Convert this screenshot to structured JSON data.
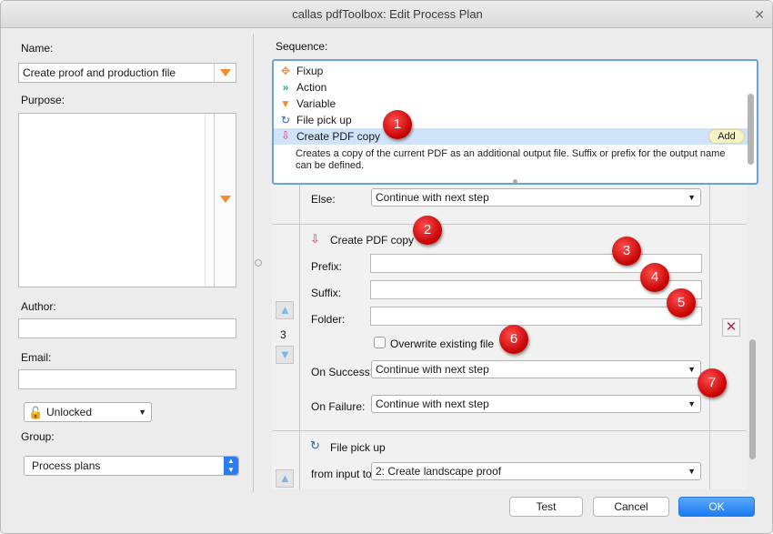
{
  "window": {
    "title": "callas pdfToolbox: Edit Process Plan"
  },
  "left": {
    "name_label": "Name:",
    "name_value": "Create proof and production file",
    "purpose_label": "Purpose:",
    "author_label": "Author:",
    "email_label": "Email:",
    "lock_value": "Unlocked",
    "group_label": "Group:",
    "group_value": "Process plans"
  },
  "sequence": {
    "label": "Sequence:",
    "items": [
      {
        "label": "Fixup",
        "icon": "fixup-icon",
        "color": "#f08c2c"
      },
      {
        "label": "Action",
        "icon": "action-icon",
        "color": "#2fb36a"
      },
      {
        "label": "Variable",
        "icon": "variable-icon",
        "color": "#f08c2c"
      },
      {
        "label": "File pick up",
        "icon": "file-pick-up-icon",
        "color": "#2a62c9"
      },
      {
        "label": "Create PDF copy",
        "icon": "create-pdf-copy-icon",
        "color": "#e0336e"
      }
    ],
    "add_label": "Add",
    "description": "Creates a copy of the current PDF as an additional output file. Suffix or prefix for the output name can be defined."
  },
  "else_step": {
    "label": "Else:",
    "value": "Continue with next step"
  },
  "pdf_copy_step": {
    "title": "Create PDF copy",
    "step_number": "3",
    "prefix_label": "Prefix:",
    "suffix_label": "Suffix:",
    "folder_label": "Folder:",
    "overwrite_label": "Overwrite existing file",
    "on_success_label": "On Success:",
    "on_success_value": "Continue with next step",
    "on_failure_label": "On Failure:",
    "on_failure_value": "Continue with next step"
  },
  "file_pickup_step": {
    "title": "File pick up",
    "from_input_label": "from input to step",
    "from_input_value": "2: Create landscape proof"
  },
  "badges": [
    "1",
    "2",
    "3",
    "4",
    "5",
    "6",
    "7"
  ],
  "buttons": {
    "test": "Test",
    "cancel": "Cancel",
    "ok": "OK"
  }
}
